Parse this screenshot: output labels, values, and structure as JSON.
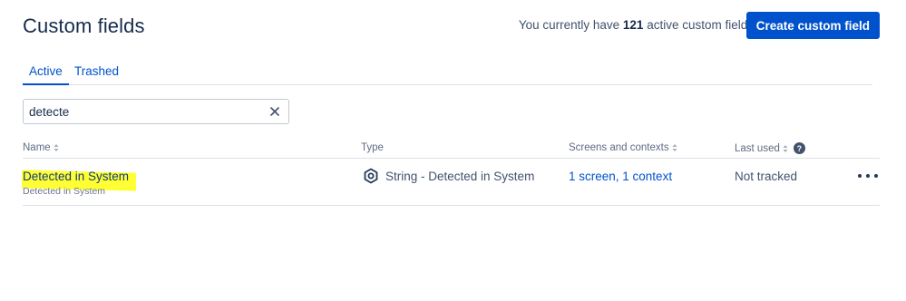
{
  "header": {
    "title": "Custom fields",
    "summary_prefix": "You currently have",
    "summary_count": "121",
    "summary_suffix": "active custom fields",
    "create_button": "Create custom field"
  },
  "tabs": [
    {
      "label": "Active",
      "active": true
    },
    {
      "label": "Trashed",
      "active": false
    }
  ],
  "search": {
    "value": "detecte",
    "placeholder": ""
  },
  "table": {
    "columns": [
      {
        "label": "Name",
        "sortable": true
      },
      {
        "label": "Type",
        "sortable": false
      },
      {
        "label": "Screens and contexts",
        "sortable": true
      },
      {
        "label": "Last used",
        "sortable": true,
        "help": "?"
      }
    ],
    "rows": [
      {
        "name": "Detected in System",
        "description": "Detected in System",
        "type_icon": "hexagon-string-icon",
        "type": "String - Detected in System",
        "contexts": "1 screen, 1 context",
        "last_used": "Not tracked",
        "actions_icon": "more-icon"
      }
    ]
  },
  "colors": {
    "primary": "#0052cc",
    "text": "#172b4d",
    "subtle": "#5e6c84",
    "highlight": "#ffff33"
  }
}
